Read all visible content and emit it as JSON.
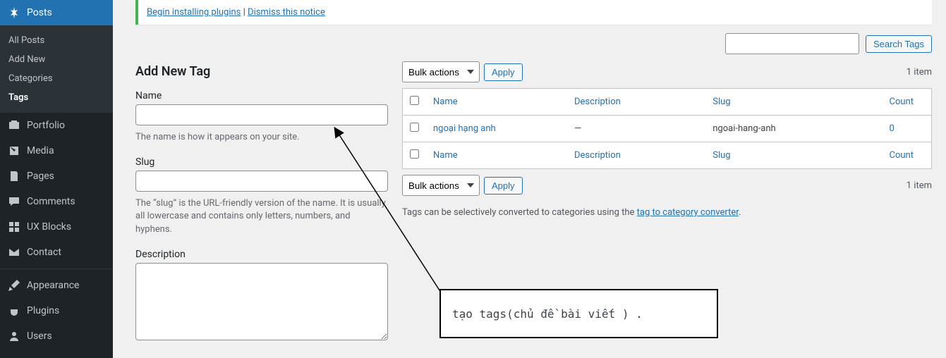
{
  "notice": {
    "install": "Begin installing plugins",
    "dismiss": "Dismiss this notice",
    "sep": " | "
  },
  "sidebar": {
    "posts": {
      "label": "Posts",
      "sub": {
        "all": "All Posts",
        "add": "Add New",
        "categories": "Categories",
        "tags": "Tags"
      }
    },
    "portfolio": "Portfolio",
    "media": "Media",
    "pages": "Pages",
    "comments": "Comments",
    "uxblocks": "UX Blocks",
    "contact": "Contact",
    "appearance": "Appearance",
    "plugins": "Plugins",
    "users": "Users"
  },
  "form": {
    "title": "Add New Tag",
    "name_label": "Name",
    "name_help": "The name is how it appears on your site.",
    "slug_label": "Slug",
    "slug_help": "The “slug” is the URL-friendly version of the name. It is usually all lowercase and contains only letters, numbers, and hyphens.",
    "desc_label": "Description"
  },
  "search": {
    "button": "Search Tags"
  },
  "bulk": {
    "label": "Bulk actions",
    "apply": "Apply"
  },
  "count_text": "1 item",
  "table": {
    "headers": {
      "name": "Name",
      "description": "Description",
      "slug": "Slug",
      "count": "Count"
    },
    "rows": [
      {
        "name": "ngoại hạng anh",
        "description": "—",
        "slug": "ngoai-hang-anh",
        "count": "0"
      }
    ]
  },
  "converter": {
    "pre": "Tags can be selectively converted to categories using the ",
    "link": "tag to category converter",
    "post": "."
  },
  "annotation": "tạo tags(chủ đề  bài viết ) ."
}
